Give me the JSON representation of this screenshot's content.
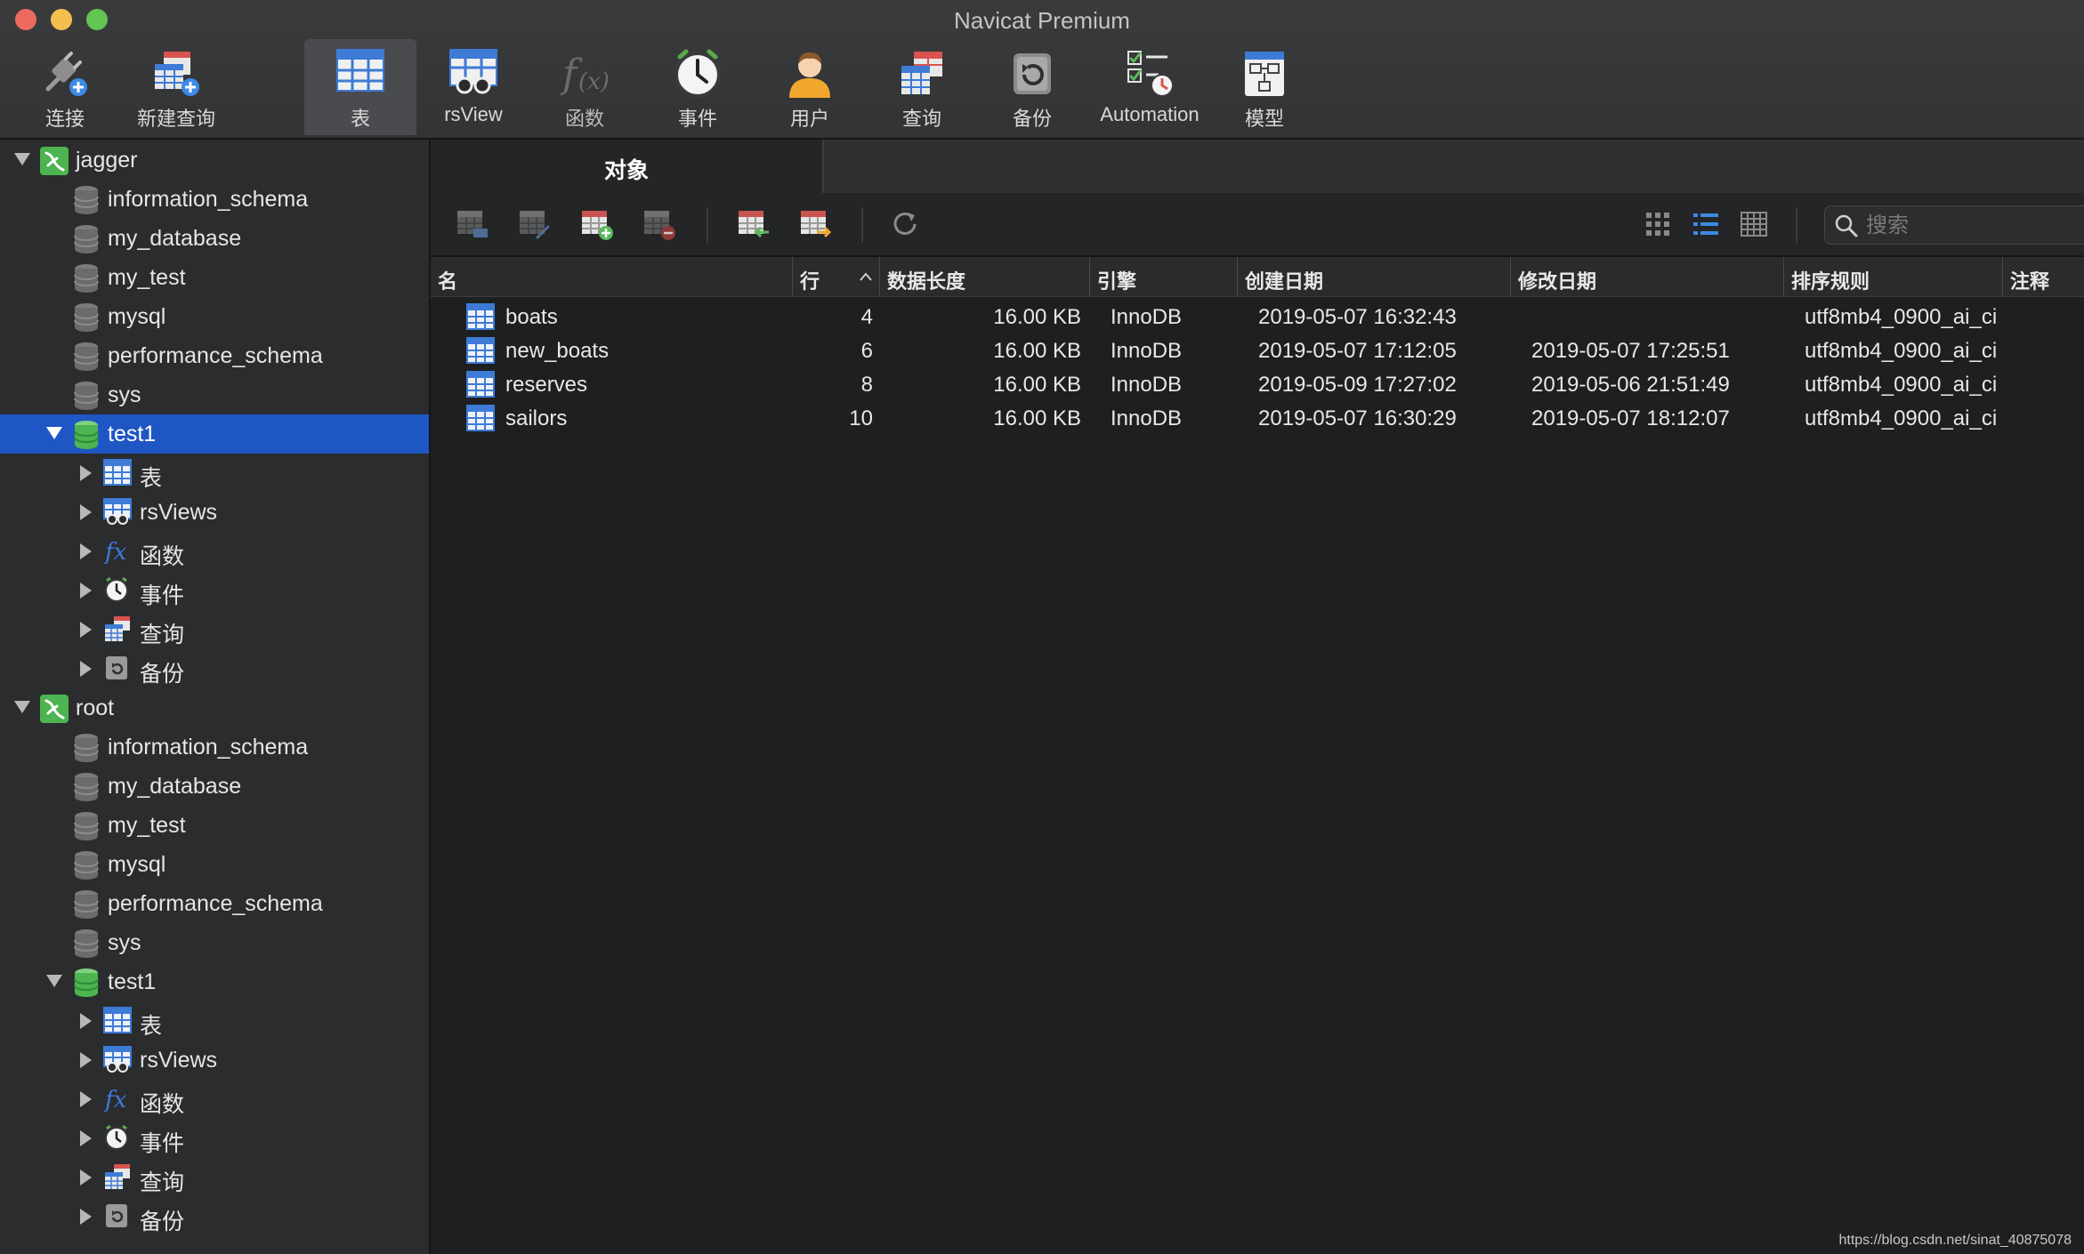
{
  "window": {
    "title": "Navicat Premium"
  },
  "toolbar": {
    "items": [
      {
        "label": "连接",
        "icon": "connection-plug-icon"
      },
      {
        "label": "新建查询",
        "icon": "new-query-icon"
      },
      {
        "label": "表",
        "icon": "table-icon",
        "active": true
      },
      {
        "label": "rsView",
        "icon": "view-icon"
      },
      {
        "label": "函数",
        "icon": "function-icon"
      },
      {
        "label": "事件",
        "icon": "clock-icon"
      },
      {
        "label": "用户",
        "icon": "user-icon"
      },
      {
        "label": "查询",
        "icon": "query-icon"
      },
      {
        "label": "备份",
        "icon": "backup-icon"
      },
      {
        "label": "Automation",
        "icon": "automation-icon"
      },
      {
        "label": "模型",
        "icon": "model-icon"
      }
    ]
  },
  "sidebar": {
    "connections": [
      {
        "name": "jagger",
        "databases": [
          "information_schema",
          "my_database",
          "my_test",
          "mysql",
          "performance_schema",
          "sys"
        ],
        "open_db": "test1",
        "open_db_items": [
          "表",
          "rsViews",
          "函数",
          "事件",
          "查询",
          "备份"
        ]
      },
      {
        "name": "root",
        "databases": [
          "information_schema",
          "my_database",
          "my_test",
          "mysql",
          "performance_schema",
          "sys"
        ],
        "open_db": "test1",
        "open_db_items": [
          "表",
          "rsViews",
          "函数",
          "事件",
          "查询",
          "备份"
        ]
      }
    ]
  },
  "main": {
    "tab": "对象",
    "search_placeholder": "搜索",
    "columns": [
      "名",
      "行",
      "数据长度",
      "引擎",
      "创建日期",
      "修改日期",
      "排序规则",
      "注释"
    ],
    "rows": [
      {
        "name": "boats",
        "rows": "4",
        "size": "16.00 KB",
        "engine": "InnoDB",
        "created": "2019-05-07 16:32:43",
        "modified": "",
        "collation": "utf8mb4_0900_ai_ci",
        "comment": ""
      },
      {
        "name": "new_boats",
        "rows": "6",
        "size": "16.00 KB",
        "engine": "InnoDB",
        "created": "2019-05-07 17:12:05",
        "modified": "2019-05-07 17:25:51",
        "collation": "utf8mb4_0900_ai_ci",
        "comment": ""
      },
      {
        "name": "reserves",
        "rows": "8",
        "size": "16.00 KB",
        "engine": "InnoDB",
        "created": "2019-05-09 17:27:02",
        "modified": "2019-05-06 21:51:49",
        "collation": "utf8mb4_0900_ai_ci",
        "comment": ""
      },
      {
        "name": "sailors",
        "rows": "10",
        "size": "16.00 KB",
        "engine": "InnoDB",
        "created": "2019-05-07 16:30:29",
        "modified": "2019-05-07 18:12:07",
        "collation": "utf8mb4_0900_ai_ci",
        "comment": ""
      }
    ]
  },
  "watermark": "https://blog.csdn.net/sinat_40875078",
  "colors": {
    "selection": "#1e56c4",
    "accent_table": "#3d7bd6",
    "db_green": "#5cb85c"
  }
}
